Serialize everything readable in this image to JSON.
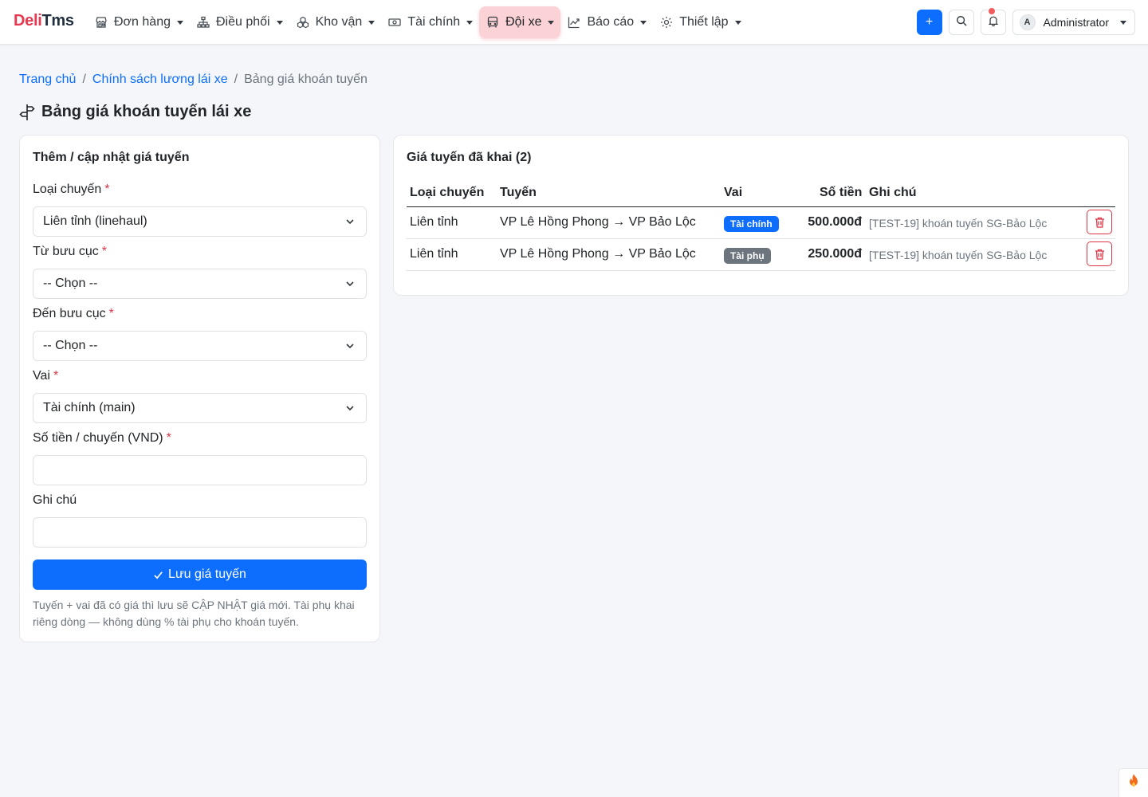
{
  "brand": {
    "part1": "Deli",
    "part2": "Tms"
  },
  "nav": {
    "items": [
      {
        "label": "Đơn hàng",
        "icon": "shop-icon"
      },
      {
        "label": "Điều phối",
        "icon": "diagram-icon"
      },
      {
        "label": "Kho vận",
        "icon": "boxes-icon"
      },
      {
        "label": "Tài chính",
        "icon": "cash-icon"
      },
      {
        "label": "Đội xe",
        "icon": "bus-icon"
      },
      {
        "label": "Báo cáo",
        "icon": "chart-line-icon"
      },
      {
        "label": "Thiết lập",
        "icon": "gear-icon"
      }
    ],
    "active_index": 4,
    "plus_label": "+",
    "user": {
      "avatar": "A",
      "name": "Administrator"
    }
  },
  "breadcrumb": {
    "home": "Trang chủ",
    "parent": "Chính sách lương lái xe",
    "current": "Bảng giá khoán tuyến",
    "sep": "/"
  },
  "page": {
    "title": "Bảng giá khoán tuyến lái xe"
  },
  "form": {
    "title": "Thêm / cập nhật giá tuyến",
    "required_mark": "*",
    "trip_type": {
      "label": "Loại chuyến",
      "value": "Liên tỉnh (linehaul)"
    },
    "from": {
      "label": "Từ bưu cục",
      "value": "-- Chọn --"
    },
    "to": {
      "label": "Đến bưu cục",
      "value": "-- Chọn --"
    },
    "role": {
      "label": "Vai",
      "value": "Tài chính (main)"
    },
    "amount": {
      "label": "Số tiền / chuyến (VND)",
      "value": ""
    },
    "note": {
      "label": "Ghi chú",
      "value": ""
    },
    "save_label": "Lưu giá tuyến",
    "hint": "Tuyến + vai đã có giá thì lưu sẽ CẬP NHẬT giá mới. Tài phụ khai riêng dòng — không dùng % tài phụ cho khoán tuyến."
  },
  "list": {
    "title": "Giá tuyến đã khai (2)",
    "columns": {
      "trip_type": "Loại chuyến",
      "route": "Tuyến",
      "role": "Vai",
      "amount": "Số tiền",
      "note": "Ghi chú"
    },
    "rows": [
      {
        "trip_type": "Liên tỉnh",
        "route": "VP Lê Hồng Phong → VP Bảo Lộc",
        "role": "Tài chính",
        "role_color": "#0d6efd",
        "amount": "500.000đ",
        "note": "[TEST-19] khoán tuyến SG-Bảo Lộc"
      },
      {
        "trip_type": "Liên tỉnh",
        "route": "VP Lê Hồng Phong → VP Bảo Lộc",
        "role": "Tài phụ",
        "role_color": "#6c757d",
        "amount": "250.000đ",
        "note": "[TEST-19] khoán tuyến SG-Bảo Lộc"
      }
    ]
  },
  "colors": {
    "primary": "#0d6efd",
    "danger": "#dc3545",
    "brand_red": "#e63950",
    "active_nav_bg": "#fbd3d6"
  }
}
